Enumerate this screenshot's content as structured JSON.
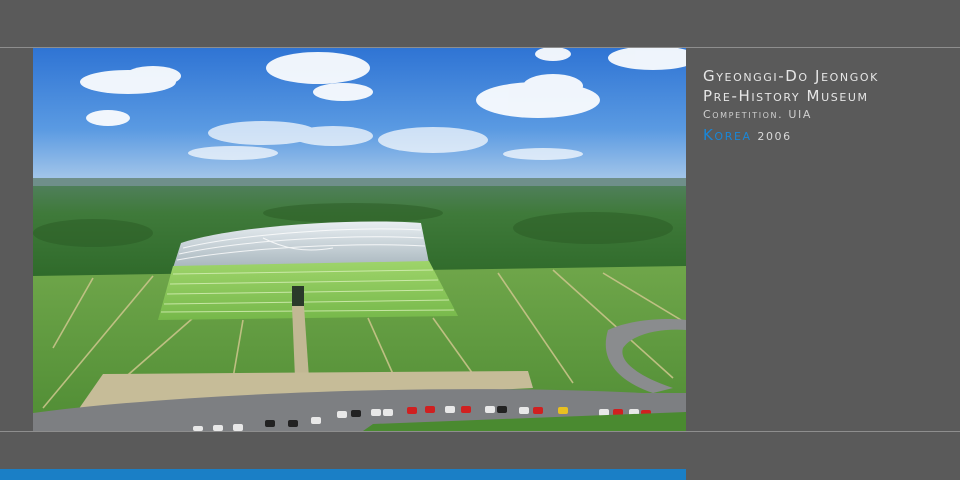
{
  "caption": {
    "title_line1": "Gyeonggi-Do Jeongok",
    "title_line2": "Pre-History Museum",
    "subtitle": "Competition. UIA",
    "country": "Korea",
    "year": "2006"
  },
  "colors": {
    "background": "#5a5a5a",
    "rule": "#8e8e8e",
    "accent": "#1a7fc6",
    "country_text": "#1a86d6",
    "caption_text": "#e6e6e6"
  },
  "image": {
    "alt": "Aerial rendering of a museum with a curved, terraced green roof set in a landscape of fields and forest under a blue sky, with a parking lot of cars in the foreground"
  }
}
